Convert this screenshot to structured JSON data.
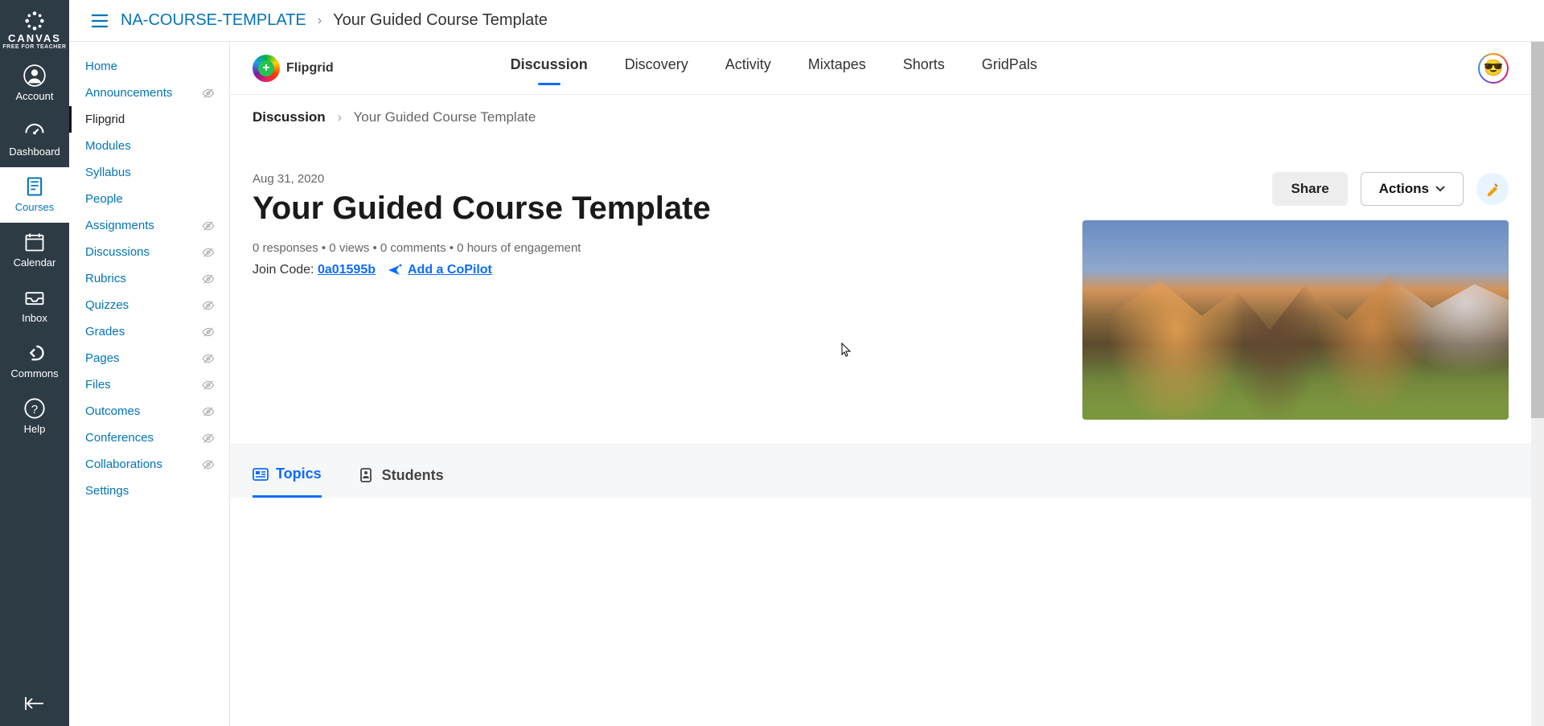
{
  "canvas_logo": {
    "brand": "CANVAS",
    "tag": "FREE FOR TEACHER"
  },
  "globalnav": [
    {
      "id": "account",
      "label": "Account"
    },
    {
      "id": "dashboard",
      "label": "Dashboard"
    },
    {
      "id": "courses",
      "label": "Courses",
      "active": true
    },
    {
      "id": "calendar",
      "label": "Calendar"
    },
    {
      "id": "inbox",
      "label": "Inbox"
    },
    {
      "id": "commons",
      "label": "Commons"
    },
    {
      "id": "help",
      "label": "Help"
    }
  ],
  "breadcrumb": {
    "course": "NA-COURSE-TEMPLATE",
    "page": "Your Guided Course Template"
  },
  "coursenav": [
    {
      "label": "Home"
    },
    {
      "label": "Announcements",
      "hidden": true
    },
    {
      "label": "Flipgrid",
      "active": true
    },
    {
      "label": "Modules"
    },
    {
      "label": "Syllabus"
    },
    {
      "label": "People"
    },
    {
      "label": "Assignments",
      "hidden": true
    },
    {
      "label": "Discussions",
      "hidden": true
    },
    {
      "label": "Rubrics",
      "hidden": true
    },
    {
      "label": "Quizzes",
      "hidden": true
    },
    {
      "label": "Grades",
      "hidden": true
    },
    {
      "label": "Pages",
      "hidden": true
    },
    {
      "label": "Files",
      "hidden": true
    },
    {
      "label": "Outcomes",
      "hidden": true
    },
    {
      "label": "Conferences",
      "hidden": true
    },
    {
      "label": "Collaborations",
      "hidden": true
    },
    {
      "label": "Settings"
    }
  ],
  "flipgrid": {
    "brand": "Flipgrid",
    "tabs": [
      "Discussion",
      "Discovery",
      "Activity",
      "Mixtapes",
      "Shorts",
      "GridPals"
    ],
    "active_tab": "Discussion",
    "avatar_emoji": "😎",
    "breadcrumb": {
      "section": "Discussion",
      "title": "Your Guided Course Template"
    },
    "date": "Aug 31, 2020",
    "title": "Your Guided Course Template",
    "stats": "0 responses • 0 views • 0 comments • 0 hours of engagement",
    "join_label": "Join Code: ",
    "join_code": "0a01595b",
    "copilot_label": "Add a CoPilot",
    "share_label": "Share",
    "actions_label": "Actions",
    "subtabs": [
      {
        "label": "Topics",
        "active": true
      },
      {
        "label": "Students"
      }
    ]
  }
}
